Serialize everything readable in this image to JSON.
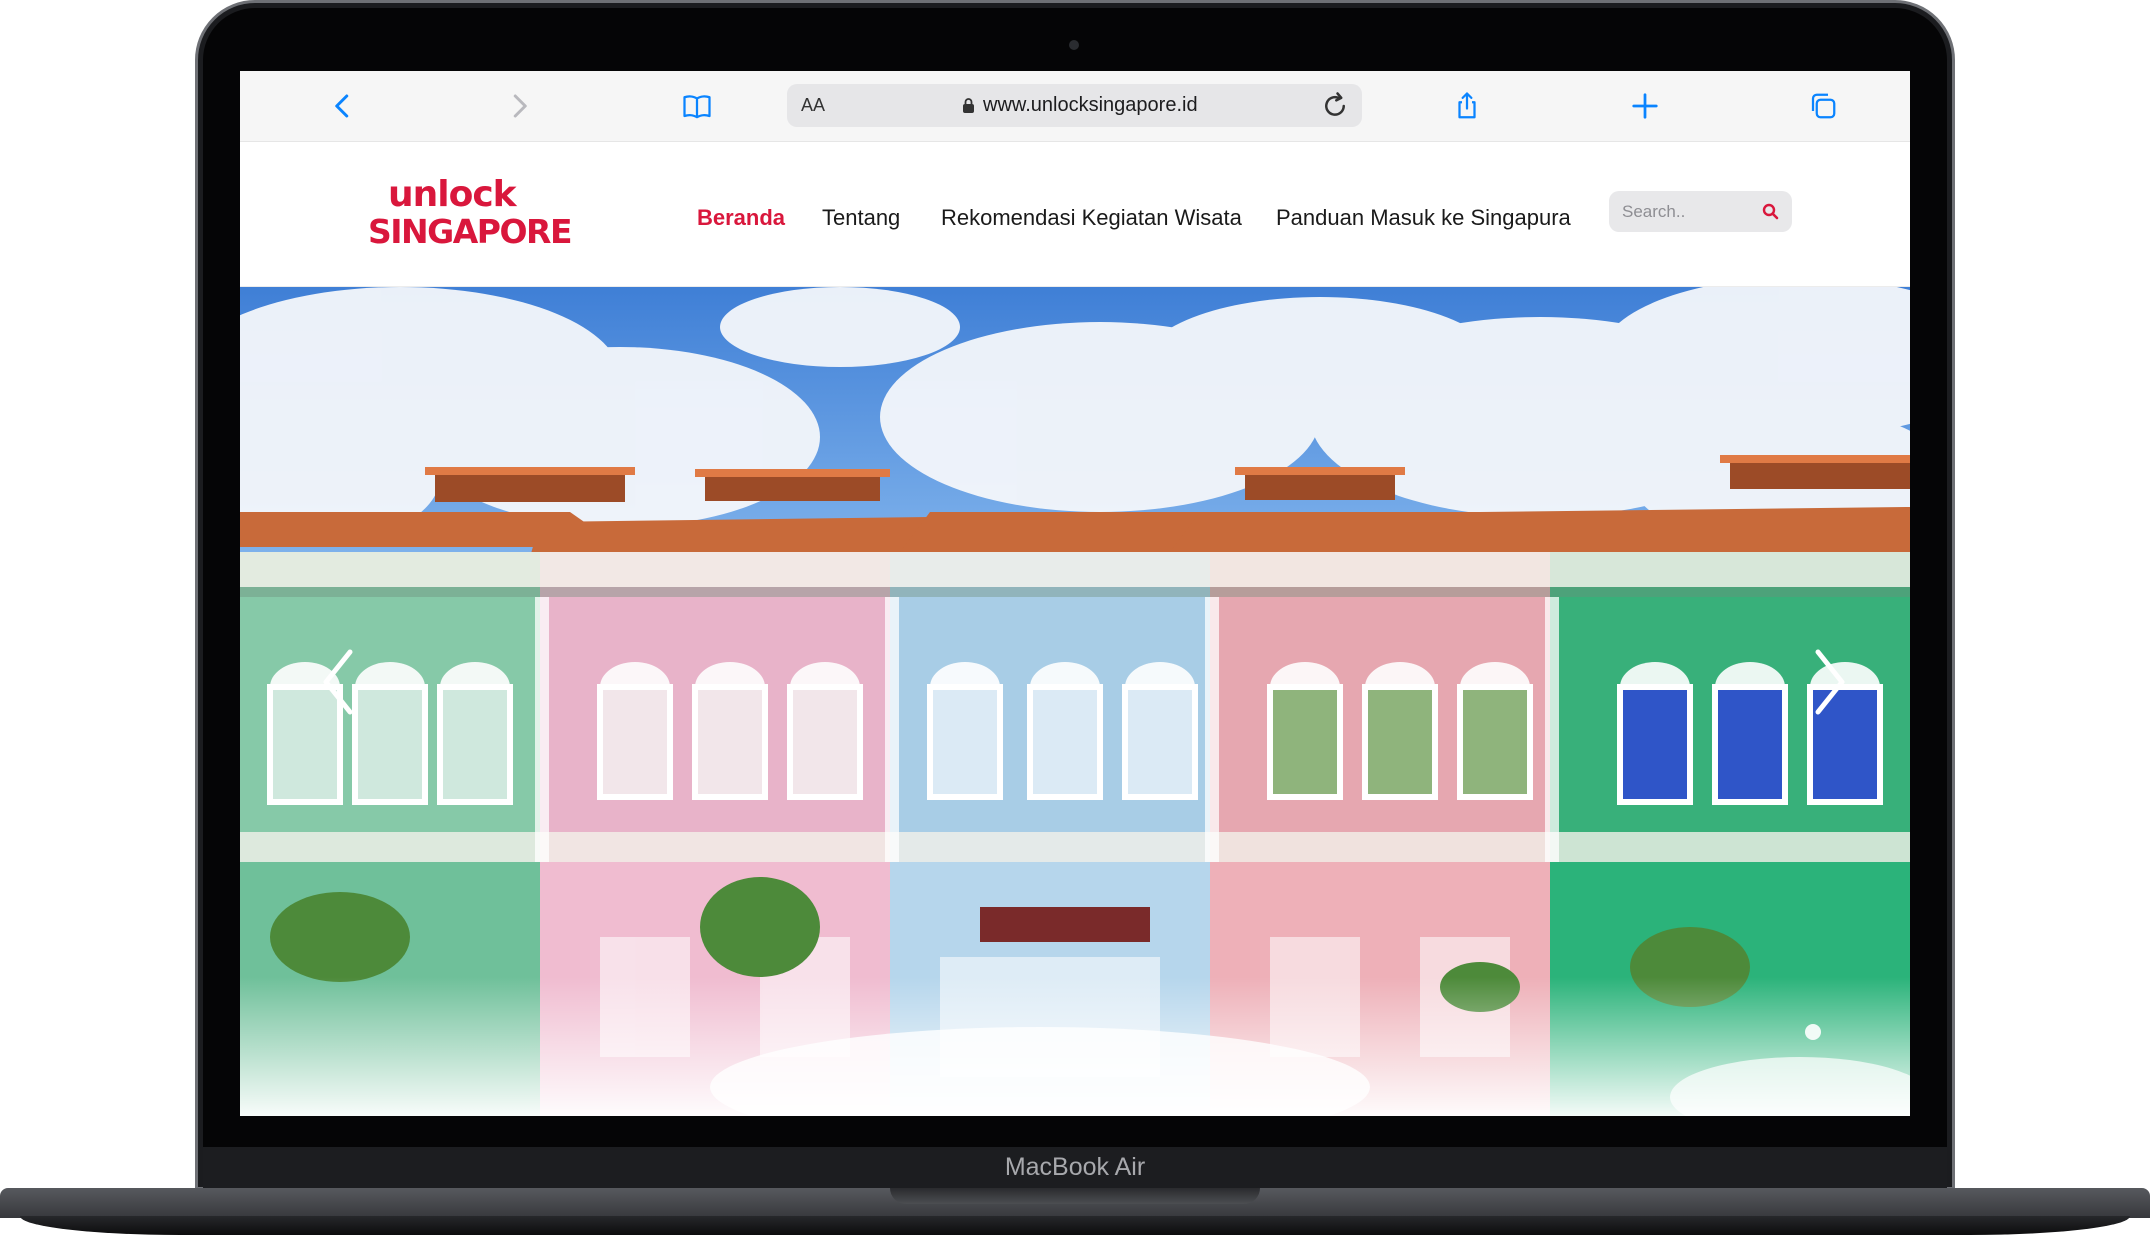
{
  "device": {
    "model_label": "MacBook Air"
  },
  "browser": {
    "text_size_label": "AA",
    "url": "www.unlocksingapore.id",
    "icons": [
      "back-icon",
      "forward-icon",
      "bookmarks-icon",
      "lock-icon",
      "reload-icon",
      "share-icon",
      "new-tab-icon",
      "tabs-icon"
    ]
  },
  "site": {
    "logo": {
      "line1": "unlock",
      "line2": "SINGAPORE"
    },
    "nav": [
      {
        "label": "Beranda",
        "active": true
      },
      {
        "label": "Tentang",
        "active": false
      },
      {
        "label": "Rekomendasi Kegiatan Wisata",
        "active": false
      },
      {
        "label": "Panduan Masuk ke Singapura",
        "active": false
      }
    ],
    "search": {
      "placeholder": "Search..",
      "icon": "search-icon"
    },
    "hero": {
      "image": "colorful peranakan shophouses under blue sky",
      "prev_icon": "chevron-left-icon",
      "next_icon": "chevron-right-icon"
    },
    "colors": {
      "brand": "#d9173c",
      "nav_text": "#1a1a1a",
      "safari_blue": "#0a84ff"
    }
  }
}
